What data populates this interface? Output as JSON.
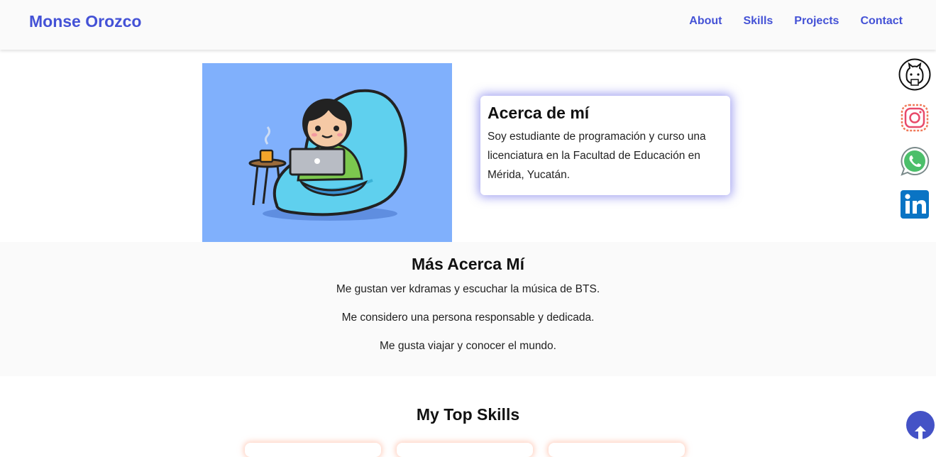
{
  "nav": {
    "brand": "Monse Orozco",
    "links": [
      {
        "label": "About"
      },
      {
        "label": "Skills"
      },
      {
        "label": "Projects"
      },
      {
        "label": "Contact"
      }
    ]
  },
  "about": {
    "title": "Acerca de mí",
    "text": "Soy estudiante de programación y curso una licenciatura en la Facultad de Educación en Mérida, Yucatán."
  },
  "more": {
    "title": "Más Acerca Mí",
    "lines": [
      "Me gustan ver kdramas y escuchar la música de BTS.",
      "Me considero una persona responsable y dedicada.",
      "Me gusta viajar y conocer el mundo."
    ]
  },
  "skills": {
    "title": "My Top Skills"
  },
  "social": {
    "icons": [
      "github-icon",
      "instagram-icon",
      "whatsapp-icon",
      "linkedin-icon"
    ]
  },
  "colors": {
    "accent": "#4452d6",
    "hero_bg": "#80b0fc",
    "section_bg": "#fafafa",
    "scroll_button": "#4452c6"
  }
}
